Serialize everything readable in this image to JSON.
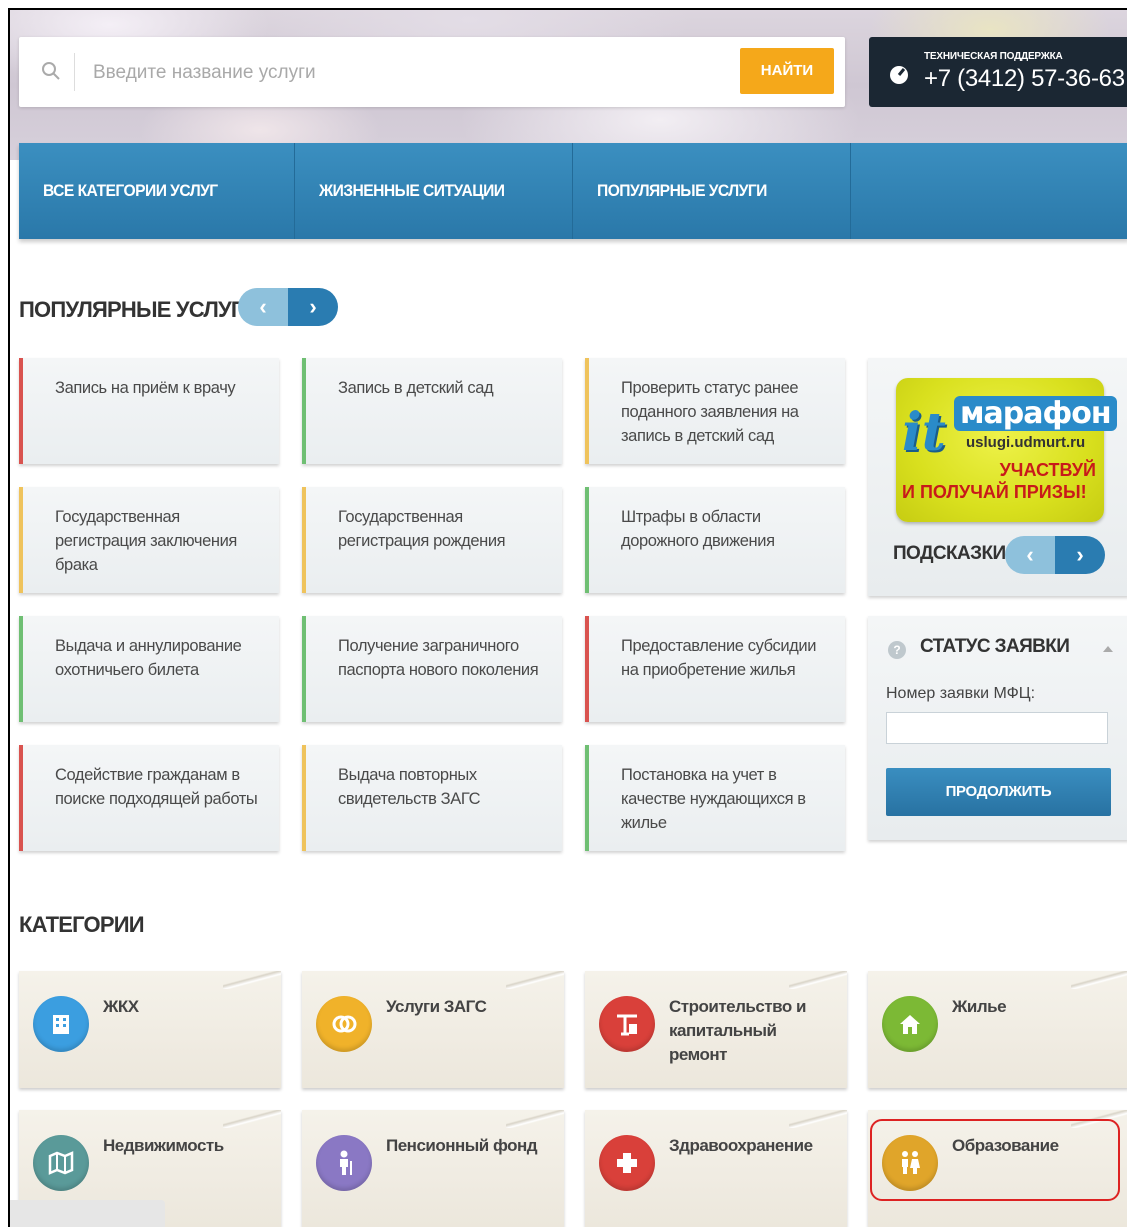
{
  "search": {
    "placeholder": "Введите название услуги",
    "button": "НАЙТИ"
  },
  "support": {
    "label": "ТЕХНИЧЕСКАЯ ПОДДЕРЖКА",
    "phone": "+7 (3412) 57-36-63"
  },
  "nav": [
    "ВСЕ КАТЕГОРИИ УСЛУГ",
    "ЖИЗНЕННЫЕ СИТУАЦИИ",
    "ПОПУЛЯРНЫЕ УСЛУГИ"
  ],
  "popular": {
    "title": "ПОПУЛЯРНЫЕ УСЛУГИ",
    "prev": "‹",
    "next": "›",
    "cards": [
      "Запись на приём к врачу",
      "Запись в детский сад",
      "Проверить статус ранее поданного заявления на запись в детский сад",
      "Государственная регистрация заключения брака",
      "Государственная регистрация рождения",
      "Штрафы в области дорожного движения",
      "Выдача и аннулирование охотничьего билета",
      "Получение заграничного паспорта нового поколения",
      "Предоставление субсидии на приобретение жилья",
      "Содействие гражданам в поиске подходящей работы",
      "Выдача повторных свидетельств ЗАГС",
      "Постановка на учет в качестве нуждающихся в жилье"
    ]
  },
  "promo": {
    "it": "it",
    "title": "марафон",
    "url": "uslugi.udmurt.ru",
    "cta1": "УЧАСТВУЙ",
    "cta2": "И ПОЛУЧАЙ ПРИЗЫ!",
    "hints": "ПОДСКАЗКИ"
  },
  "status": {
    "q": "?",
    "title": "СТАТУС ЗАЯВКИ",
    "label": "Номер заявки МФЦ:",
    "value": "",
    "button": "ПРОДОЛЖИТЬ"
  },
  "categories": {
    "title": "КАТЕГОРИИ",
    "items": [
      {
        "label": "ЖКХ",
        "icon": "building-icon",
        "color": "#3b9ee0"
      },
      {
        "label": "Услуги ЗАГС",
        "icon": "rings-icon",
        "color": "#f0b22a"
      },
      {
        "label": "Строительство и капитальный ремонт",
        "icon": "crane-icon",
        "color": "#d9403a"
      },
      {
        "label": "Жилье",
        "icon": "house-icon",
        "color": "#7cb935"
      },
      {
        "label": "Недвижимость",
        "icon": "map-icon",
        "color": "#5a9a99"
      },
      {
        "label": "Пенсионный фонд",
        "icon": "elder-icon",
        "color": "#8a78c4"
      },
      {
        "label": "Здравоохранение",
        "icon": "medical-cross-icon",
        "color": "#d9403a"
      },
      {
        "label": "Образование",
        "icon": "children-icon",
        "color": "#e0a52a"
      }
    ]
  },
  "colors": {
    "accent": "#2a7cb1",
    "search_button": "#f5a81a",
    "support_bg": "#1b2733",
    "highlight": "#dd2222"
  }
}
